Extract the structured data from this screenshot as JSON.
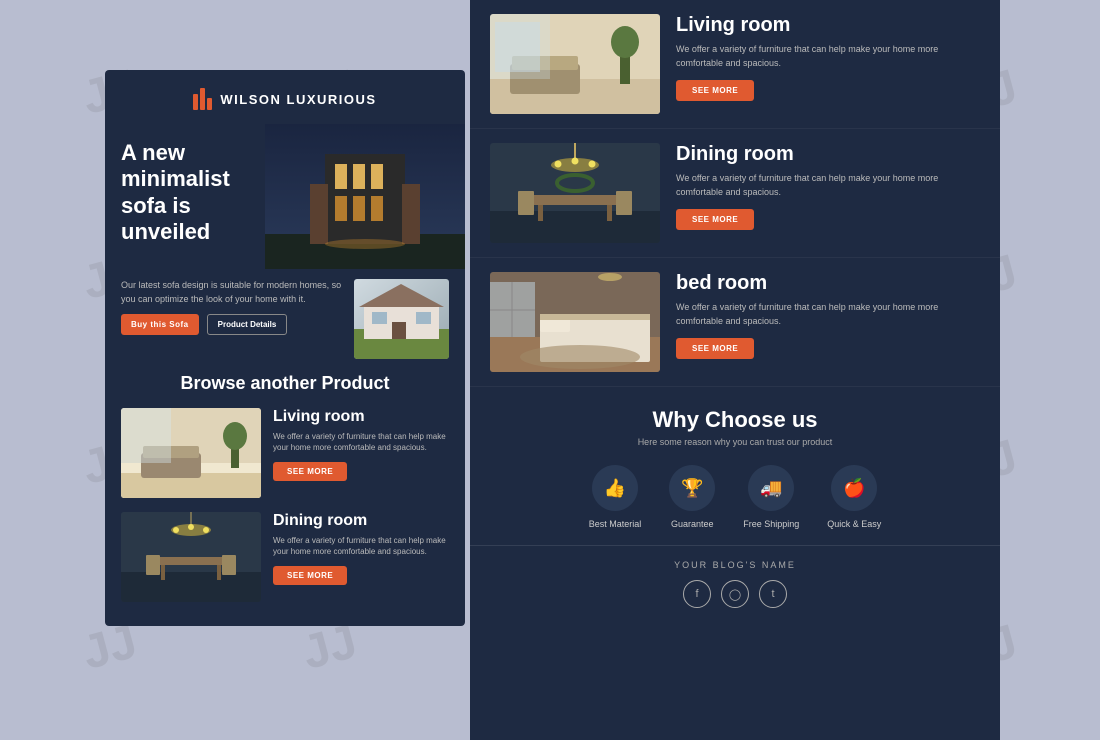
{
  "background": {
    "color": "#b8bdd0"
  },
  "brand": {
    "name": "WILSON LUXURIOUS",
    "logo_bars": 3
  },
  "hero": {
    "headline": "A new minimalist sofa is unveiled",
    "description": "Our latest sofa design is suitable for modern homes, so you can optimize the look of your home with it.",
    "buy_button": "Buy this Sofa",
    "details_button": "Product Details"
  },
  "browse": {
    "title": "Browse another Product",
    "items": [
      {
        "title": "Living room",
        "description": "We offer a variety of furniture that can help make your home more comfortable and spacious.",
        "see_more": "SEE MORE"
      },
      {
        "title": "Dining room",
        "description": "We offer a variety of furniture that can help make your home more comfortable and spacious.",
        "see_more": "SEE MORE"
      }
    ]
  },
  "right_products": [
    {
      "title": "Living room",
      "description": "We offer a variety of furniture that can help make your home more comfortable and spacious.",
      "see_more": "SEE MORE"
    },
    {
      "title": "Dining room",
      "description": "We offer a variety of furniture that can help make your home more comfortable and spacious.",
      "see_more": "SEE MORE"
    },
    {
      "title": "bed room",
      "description": "We offer a variety of furniture that can help make your home more comfortable and spacious.",
      "see_more": "SEE MORE"
    }
  ],
  "why_choose": {
    "title": "Why Choose us",
    "subtitle": "Here some reason why you can trust our product",
    "features": [
      {
        "label": "Best Material",
        "icon": "👍"
      },
      {
        "label": "Guarantee",
        "icon": "🏆"
      },
      {
        "label": "Free Shipping",
        "icon": "🚚"
      },
      {
        "label": "Quick & Easy",
        "icon": "🍎"
      }
    ]
  },
  "footer": {
    "blog_name": "YOUR BLOG'S NAME",
    "social": [
      "f",
      "ig",
      "tw"
    ]
  }
}
